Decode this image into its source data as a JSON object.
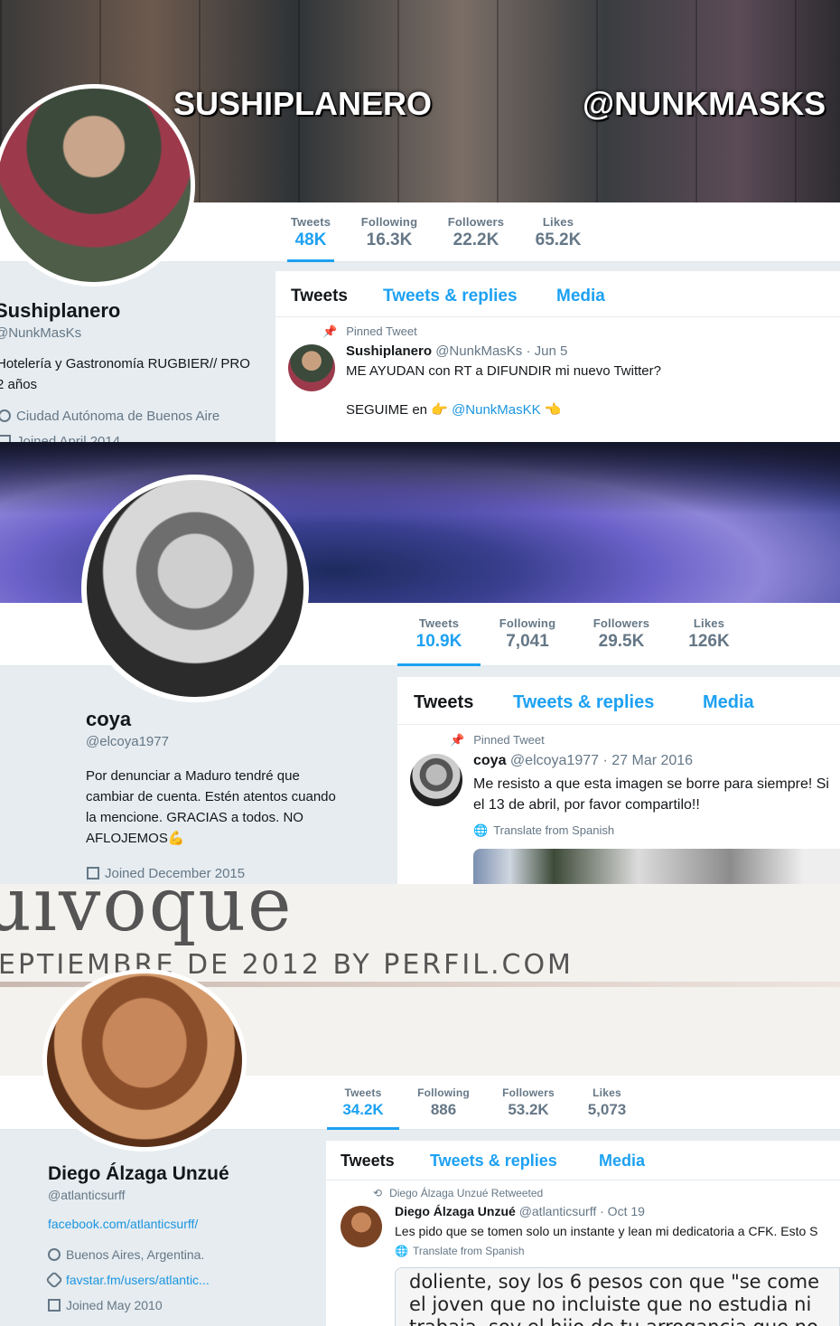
{
  "profiles": [
    {
      "banner_text_left": "SUSHIPLANERO",
      "banner_text_right": "@NUNKMASKS",
      "stats": [
        {
          "label": "Tweets",
          "value": "48K",
          "active": true
        },
        {
          "label": "Following",
          "value": "16.3K"
        },
        {
          "label": "Followers",
          "value": "22.2K"
        },
        {
          "label": "Likes",
          "value": "65.2K"
        }
      ],
      "name": "Sushiplanero",
      "handle": "@NunkMasKs",
      "bio_line1": "Hotelería y Gastronomía RUGBIER// PRO",
      "bio_line2": "2 años",
      "location": "Ciudad Autónoma de Buenos Aire",
      "joined": "Joined April 2014",
      "tabs": [
        "Tweets",
        "Tweets & replies",
        "Media"
      ],
      "pinned_label": "Pinned Tweet",
      "tweet": {
        "name": "Sushiplanero",
        "handle": "@NunkMasKs",
        "date": "· Jun 5",
        "line1": "ME AYUDAN con RT a DIFUNDIR mi nuevo Twitter?",
        "line2_prefix": "SEGUIME en",
        "mention": "@NunkMasKK"
      }
    },
    {
      "stats": [
        {
          "label": "Tweets",
          "value": "10.9K",
          "active": true
        },
        {
          "label": "Following",
          "value": "7,041"
        },
        {
          "label": "Followers",
          "value": "29.5K"
        },
        {
          "label": "Likes",
          "value": "126K"
        }
      ],
      "name": "coya",
      "handle": "@elcoya1977",
      "bio_lines": [
        "Por denunciar a Maduro tendré que",
        "cambiar de cuenta. Estén atentos cuando",
        "la mencione. GRACIAS a todos. NO",
        "AFLOJEMOS💪"
      ],
      "joined": "Joined December 2015",
      "tabs": [
        "Tweets",
        "Tweets & replies",
        "Media"
      ],
      "pinned_label": "Pinned Tweet",
      "tweet": {
        "name": "coya",
        "handle": "@elcoya1977",
        "date": "· 27 Mar 2016",
        "line1": "Me resisto a que esta imagen se borre para siempre! Si",
        "line2": "el 13 de abril, por favor compartilo!!",
        "translate": "Translate from Spanish"
      }
    },
    {
      "banner_text_large": "uivoque",
      "banner_text_small": "EPTIEMBRE DE 2012 BY PERFIL.COM",
      "stats": [
        {
          "label": "Tweets",
          "value": "34.2K",
          "active": true
        },
        {
          "label": "Following",
          "value": "886"
        },
        {
          "label": "Followers",
          "value": "53.2K"
        },
        {
          "label": "Likes",
          "value": "5,073"
        }
      ],
      "name": "Diego Álzaga Unzué",
      "handle": "@atlanticsurff",
      "website": "facebook.com/atlanticsurff/",
      "location": "Buenos Aires, Argentina.",
      "link": "favstar.fm/users/atlantic...",
      "joined": "Joined May 2010",
      "tabs": [
        "Tweets",
        "Tweets & replies",
        "Media"
      ],
      "retweeted_label": "Diego Álzaga Unzué Retweeted",
      "tweet": {
        "name": "Diego Álzaga Unzué",
        "handle": "@atlanticsurff",
        "date": "· Oct 19",
        "line1": "Les pido que se tomen solo un instante y lean mi dedicatoria a CFK. Esto S",
        "translate": "Translate from Spanish",
        "image_lines": [
          "doliente, soy los 6 pesos con que \"se come",
          "el joven que no incluiste que no estudia ni",
          "trabaja, soy el hijo de tu arrogancia que no"
        ]
      }
    }
  ],
  "colors": {
    "accent": "#1da1f2",
    "muted": "#657786",
    "bg": "#e6ecf0"
  }
}
